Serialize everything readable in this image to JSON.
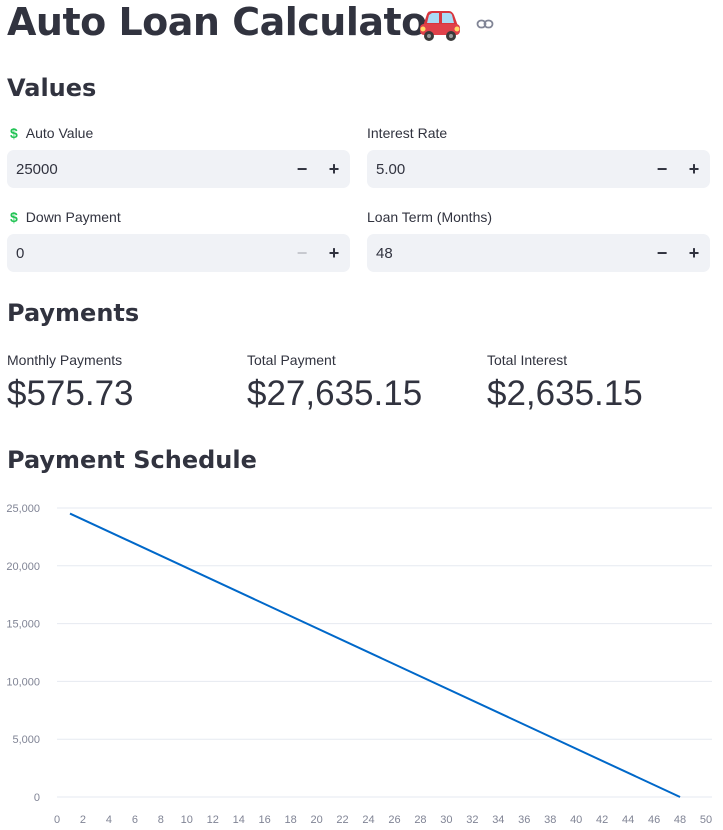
{
  "header": {
    "title": "Auto Loan Calculator",
    "car_icon": "red-car-icon",
    "link_icon": "link-icon"
  },
  "values_section": {
    "heading": "Values",
    "auto_value": {
      "label": "Auto Value",
      "value": "25000",
      "icon": "dollar-icon"
    },
    "interest_rate": {
      "label": "Interest Rate",
      "value": "5.00"
    },
    "down_payment": {
      "label": "Down Payment",
      "value": "0",
      "icon": "dollar-icon",
      "minus_disabled": true
    },
    "loan_term": {
      "label": "Loan Term (Months)",
      "value": "48"
    },
    "minus_symbol": "−",
    "plus_symbol": "+"
  },
  "payments_section": {
    "heading": "Payments",
    "monthly": {
      "label": "Monthly Payments",
      "value": "$575.73"
    },
    "total": {
      "label": "Total Payment",
      "value": "$27,635.15"
    },
    "interest": {
      "label": "Total Interest",
      "value": "$2,635.15"
    }
  },
  "schedule_section": {
    "heading": "Payment Schedule"
  },
  "colors": {
    "accent_line": "#0068c9",
    "dollar_green": "#21c354",
    "input_bg": "#f0f2f6",
    "text": "#31333f"
  },
  "chart_data": {
    "type": "line",
    "title": "",
    "xlabel": "",
    "ylabel": "",
    "x": [
      1,
      48
    ],
    "y": [
      24521,
      0
    ],
    "xlim": [
      0,
      50
    ],
    "ylim": [
      0,
      25000
    ],
    "x_ticks": [
      0,
      2,
      4,
      6,
      8,
      10,
      12,
      14,
      16,
      18,
      20,
      22,
      24,
      26,
      28,
      30,
      32,
      34,
      36,
      38,
      40,
      42,
      44,
      46,
      48,
      50
    ],
    "y_ticks": [
      0,
      5000,
      10000,
      15000,
      20000,
      25000
    ],
    "y_tick_labels": [
      "0",
      "5,000",
      "10,000",
      "15,000",
      "20,000",
      "25,000"
    ],
    "grid": true,
    "series_color": "#0068c9"
  }
}
